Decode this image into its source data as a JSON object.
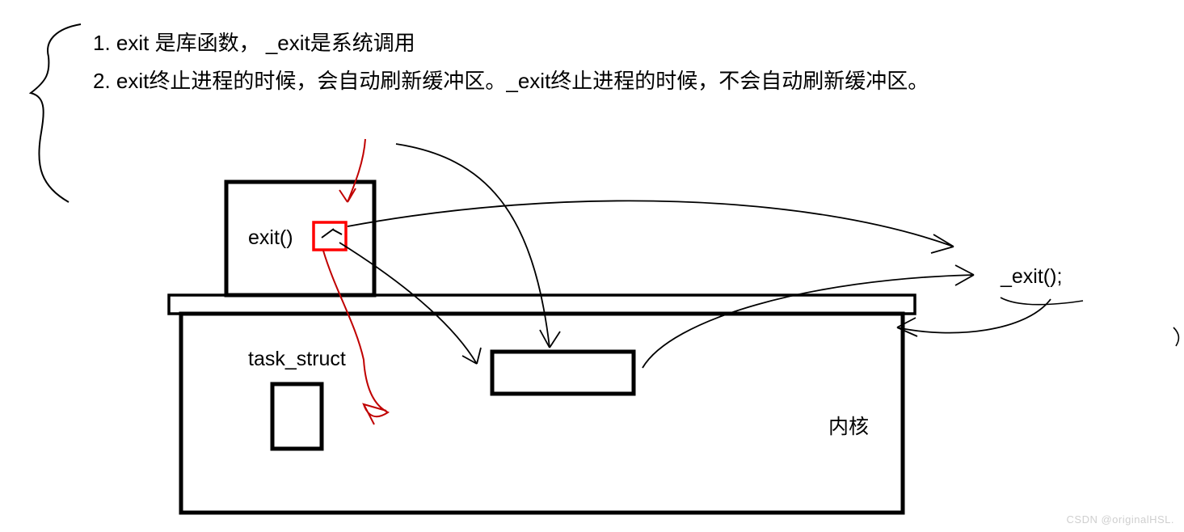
{
  "notes": {
    "line1": "1. exit 是库函数，  _exit是系统调用",
    "line2": "2. exit终止进程的时候，会自动刷新缓冲区。_exit终止进程的时候，不会自动刷新缓冲区。"
  },
  "diagram": {
    "exit_label": "exit()",
    "underscore_exit_label": "_exit();",
    "task_struct_label": "task_struct",
    "kernel_label": "内核",
    "box_colors": {
      "outline": "#000000",
      "red_highlight": "#ff0000",
      "red_stroke": "#c00000",
      "black_stroke": "#000000"
    }
  },
  "watermark": "CSDN @originalHSL."
}
